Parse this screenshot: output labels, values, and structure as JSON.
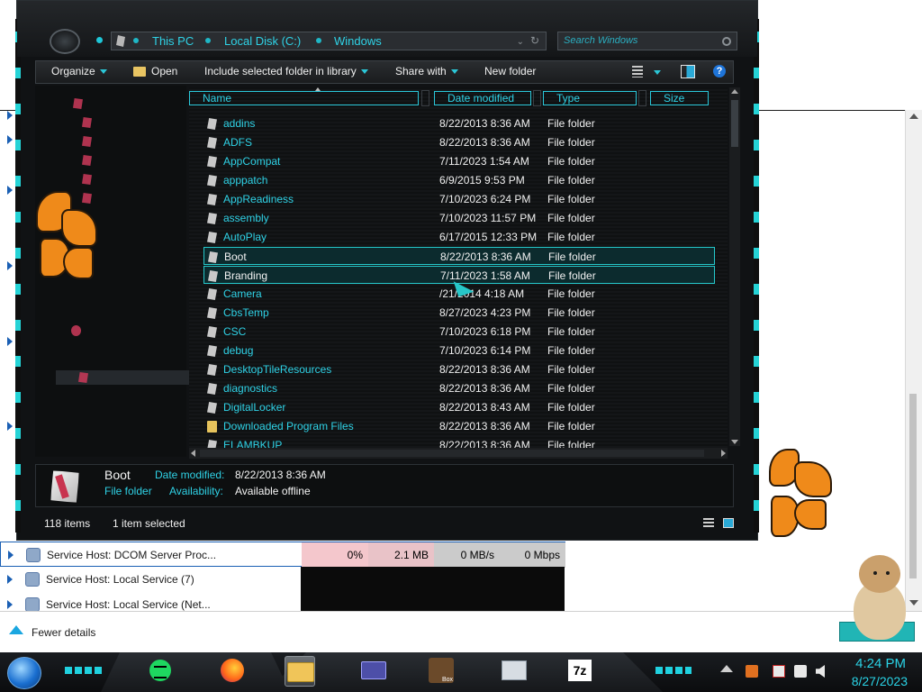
{
  "explorer": {
    "address": [
      "This PC",
      "Local Disk (C:)",
      "Windows"
    ],
    "search_placeholder": "Search Windows",
    "toolbar": {
      "organize": "Organize",
      "open": "Open",
      "include": "Include selected folder in library",
      "share": "Share with",
      "new_folder": "New folder"
    },
    "columns": [
      "Name",
      "Date modified",
      "Type",
      "Size"
    ],
    "files": [
      {
        "name": "addins",
        "date": "8/22/2013 8:36 AM",
        "type": "File folder"
      },
      {
        "name": "ADFS",
        "date": "8/22/2013 8:36 AM",
        "type": "File folder"
      },
      {
        "name": "AppCompat",
        "date": "7/11/2023 1:54 AM",
        "type": "File folder"
      },
      {
        "name": "apppatch",
        "date": "6/9/2015 9:53 PM",
        "type": "File folder"
      },
      {
        "name": "AppReadiness",
        "date": "7/10/2023 6:24 PM",
        "type": "File folder"
      },
      {
        "name": "assembly",
        "date": "7/10/2023 11:57 PM",
        "type": "File folder"
      },
      {
        "name": "AutoPlay",
        "date": "6/17/2015 12:33 PM",
        "type": "File folder"
      },
      {
        "name": "Boot",
        "date": "8/22/2013 8:36 AM",
        "type": "File folder"
      },
      {
        "name": "Branding",
        "date": "7/11/2023 1:58 AM",
        "type": "File folder"
      },
      {
        "name": "Camera",
        "date": "/21/2014 4:18 AM",
        "type": "File folder"
      },
      {
        "name": "CbsTemp",
        "date": "8/27/2023 4:23 PM",
        "type": "File folder"
      },
      {
        "name": "CSC",
        "date": "7/10/2023 6:18 PM",
        "type": "File folder"
      },
      {
        "name": "debug",
        "date": "7/10/2023 6:14 PM",
        "type": "File folder"
      },
      {
        "name": "DesktopTileResources",
        "date": "8/22/2013 8:36 AM",
        "type": "File folder"
      },
      {
        "name": "diagnostics",
        "date": "8/22/2013 8:36 AM",
        "type": "File folder"
      },
      {
        "name": "DigitalLocker",
        "date": "8/22/2013 8:43 AM",
        "type": "File folder"
      },
      {
        "name": "Downloaded Program Files",
        "date": "8/22/2013 8:36 AM",
        "type": "File folder"
      },
      {
        "name": "ELAMBKUP",
        "date": "8/22/2013 8:36 AM",
        "type": "File folder"
      }
    ],
    "details": {
      "name": "Boot",
      "type": "File folder",
      "date_label": "Date modified:",
      "date_value": "8/22/2013 8:36 AM",
      "avail_label": "Availability:",
      "avail_value": "Available offline"
    },
    "status": {
      "items": "118 items",
      "selected": "1 item selected"
    }
  },
  "taskmgr": {
    "rows": [
      {
        "name": "Service Host: DCOM Server Proc...",
        "cpu": "0%",
        "mem": "2.1 MB",
        "disk": "0 MB/s",
        "net": "0 Mbps"
      },
      {
        "name": "Service Host: Local Service (7)"
      },
      {
        "name": "Service Host: Local Service (Net..."
      }
    ],
    "fewer_details": "Fewer details"
  },
  "taskbar": {
    "time": "4:24 PM",
    "date": "8/27/2023",
    "seven_zip": "7z",
    "box_label": "Box"
  }
}
